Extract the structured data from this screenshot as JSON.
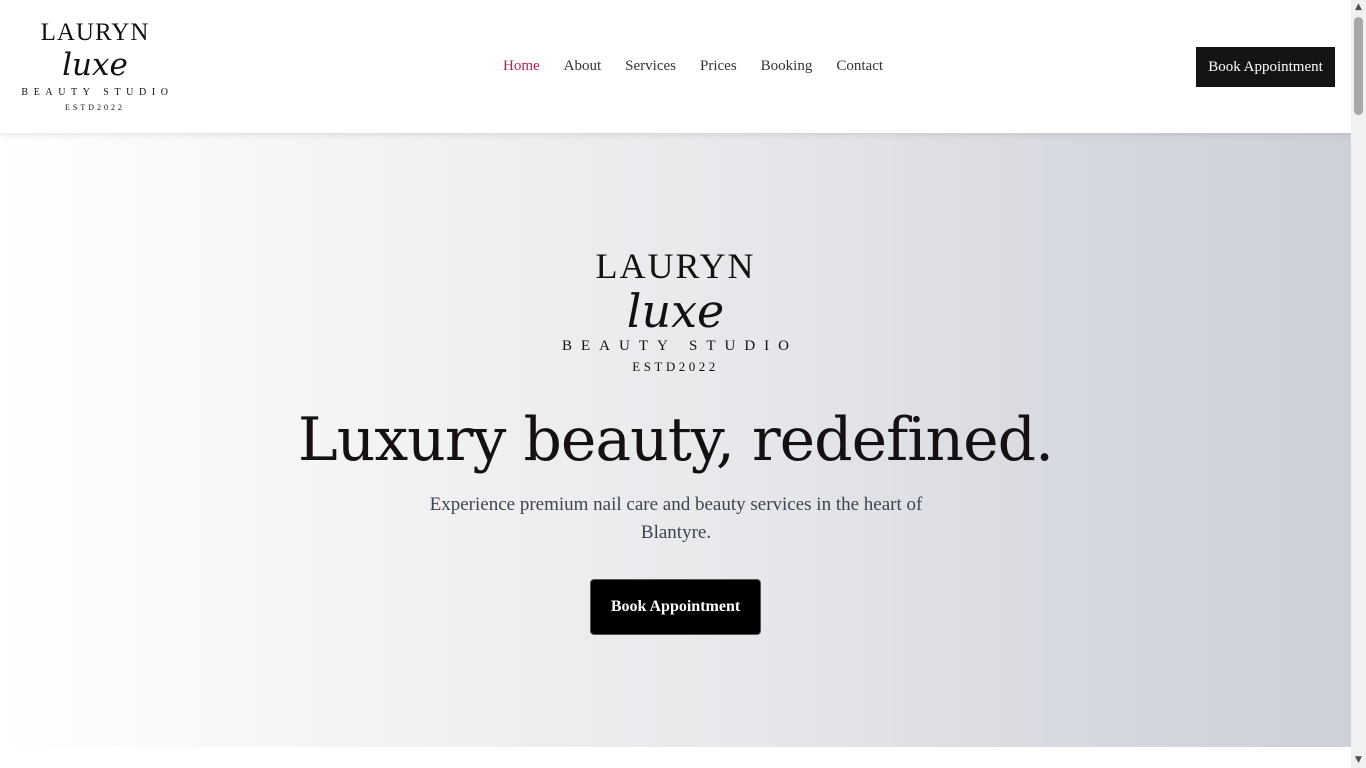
{
  "brand": {
    "name": "LAURYN",
    "script": "luxe",
    "tagline": "BEAUTY STUDIO",
    "established": "ESTD2022"
  },
  "nav": {
    "items": [
      {
        "label": "Home",
        "active": true
      },
      {
        "label": "About",
        "active": false
      },
      {
        "label": "Services",
        "active": false
      },
      {
        "label": "Prices",
        "active": false
      },
      {
        "label": "Booking",
        "active": false
      },
      {
        "label": "Contact",
        "active": false
      }
    ],
    "cta_label": "Book Appointment"
  },
  "hero": {
    "headline": "Luxury beauty, redefined.",
    "subtext": "Experience premium nail care and beauty services in the heart of Blantyre.",
    "cta_label": "Book Appointment"
  },
  "colors": {
    "accent_active_nav": "#c2185b",
    "button_dark": "#141414",
    "text_dark": "#141014",
    "subtext": "#3d4451"
  },
  "scrollbar": {
    "up_icon": "triangle-up",
    "down_icon": "triangle-down"
  }
}
